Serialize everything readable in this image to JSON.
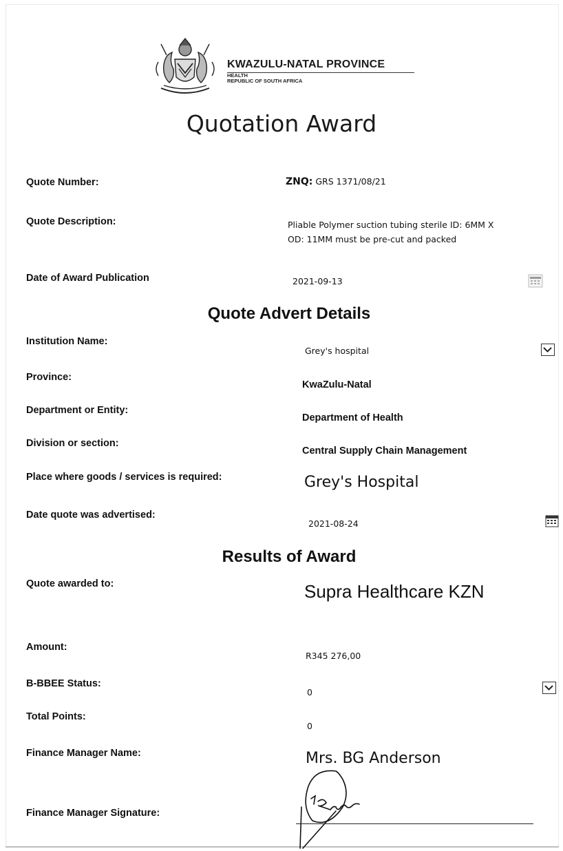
{
  "header": {
    "org_name": "KWAZULU-NATAL PROVINCE",
    "org_dept": "HEALTH",
    "org_country": "REPUBLIC OF SOUTH AFRICA",
    "crest_icon": "provincial-coat-of-arms"
  },
  "title": "Quotation Award",
  "quote": {
    "number_label": "Quote Number:",
    "number_prefix": "ZNQ:",
    "number_value": "GRS 1371/08/21",
    "description_label": "Quote Description:",
    "description_line1": "Pliable Polymer suction tubing sterile ID: 6MM X",
    "description_line2": "OD: 11MM must be pre-cut and packed",
    "award_date_label": "Date of Award Publication",
    "award_date_value": "2021-09-13"
  },
  "advert": {
    "section_title": "Quote Advert Details",
    "institution_label": "Institution Name:",
    "institution_value": "Grey's hospital",
    "province_label": "Province:",
    "province_value": "KwaZulu-Natal",
    "department_label": "Department or Entity:",
    "department_value": "Department of Health",
    "division_label": "Division or section:",
    "division_value": "Central Supply Chain Management",
    "place_label": "Place where goods /  services is required:",
    "place_value": "Grey's Hospital",
    "advertised_label": "Date quote was advertised:",
    "advertised_value": "2021-08-24"
  },
  "results": {
    "section_title": "Results of Award",
    "awarded_to_label": "Quote awarded to:",
    "awarded_to_value": "Supra Healthcare KZN",
    "amount_label": "Amount:",
    "amount_value": "R345 276,00",
    "bbbee_label": "B-BBEE Status:",
    "bbbee_value": "0",
    "points_label": "Total Points:",
    "points_value": "0",
    "manager_name_label": "Finance Manager Name:",
    "manager_name_value": "Mrs. BG Anderson",
    "manager_signature_label": "Finance Manager Signature:"
  }
}
